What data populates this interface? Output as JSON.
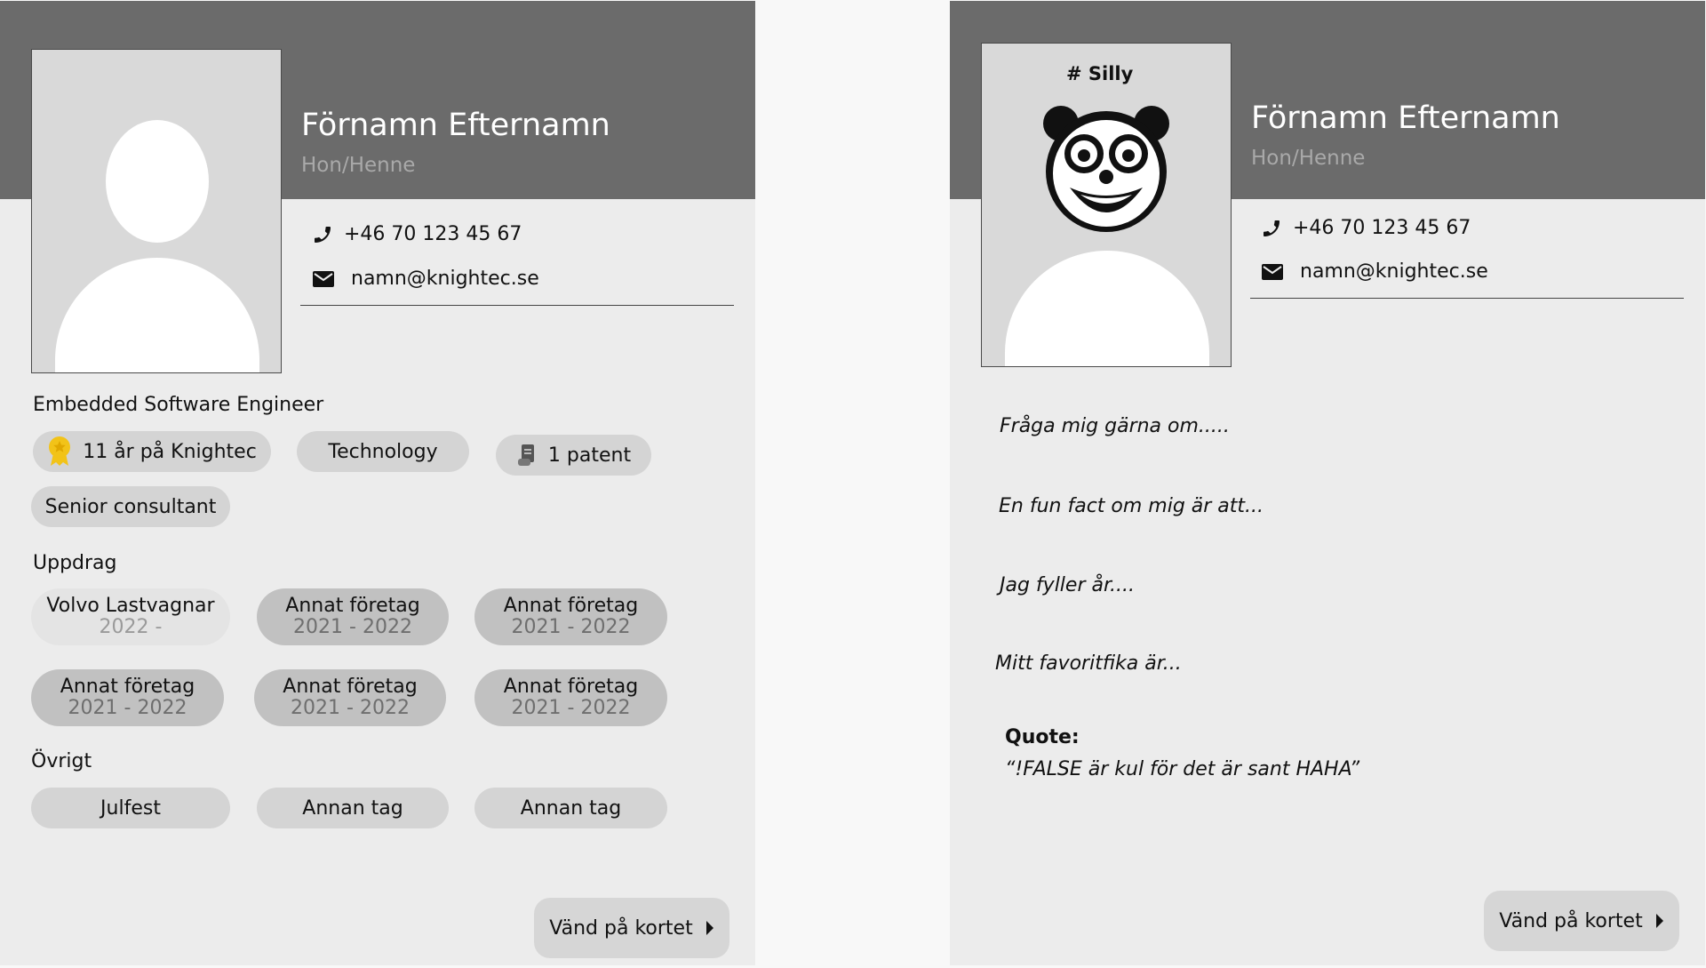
{
  "front": {
    "name": "Förnamn Efternamn",
    "pronouns": "Hon/Henne",
    "phone": "+46 70 123 45 67",
    "email": "namn@knightec.se",
    "role": "Embedded Software Engineer",
    "tags": {
      "tenure": "11 år på Knightec",
      "area": "Technology",
      "patents": "1 patent",
      "level": "Senior consultant"
    },
    "assignments_heading": "Uppdrag",
    "assignments": [
      {
        "company": "Volvo Lastvagnar",
        "years": "2022 -"
      },
      {
        "company": "Annat företag",
        "years": "2021 - 2022"
      },
      {
        "company": "Annat företag",
        "years": "2021 - 2022"
      },
      {
        "company": "Annat företag",
        "years": "2021 - 2022"
      },
      {
        "company": "Annat företag",
        "years": "2021 - 2022"
      },
      {
        "company": "Annat företag",
        "years": "2021 - 2022"
      }
    ],
    "other_heading": "Övrigt",
    "other_tags": [
      "Julfest",
      "Annan tag",
      "Annan tag"
    ],
    "flip_label": "Vänd på kortet"
  },
  "back": {
    "name": "Förnamn Efternamn",
    "pronouns": "Hon/Henne",
    "phone": "+46 70 123 45 67",
    "email": "namn@knightec.se",
    "photo_tag": "# Silly",
    "prompts": [
      "Fråga mig gärna om.....",
      "En fun fact om mig är att...",
      "Jag fyller år....",
      "Mitt favoritfika är..."
    ],
    "quote_label": "Quote:",
    "quote_text": "“!FALSE är kul för det är sant HAHA”",
    "flip_label": "Vänd på kortet"
  },
  "colors": {
    "header": "#6b6b6b",
    "card": "#ececec",
    "tenure_badge": "#f2c318"
  },
  "icons": [
    "phone-icon",
    "mail-icon",
    "award-icon",
    "scroll-icon",
    "caret-right-icon",
    "silly-face-icon"
  ]
}
